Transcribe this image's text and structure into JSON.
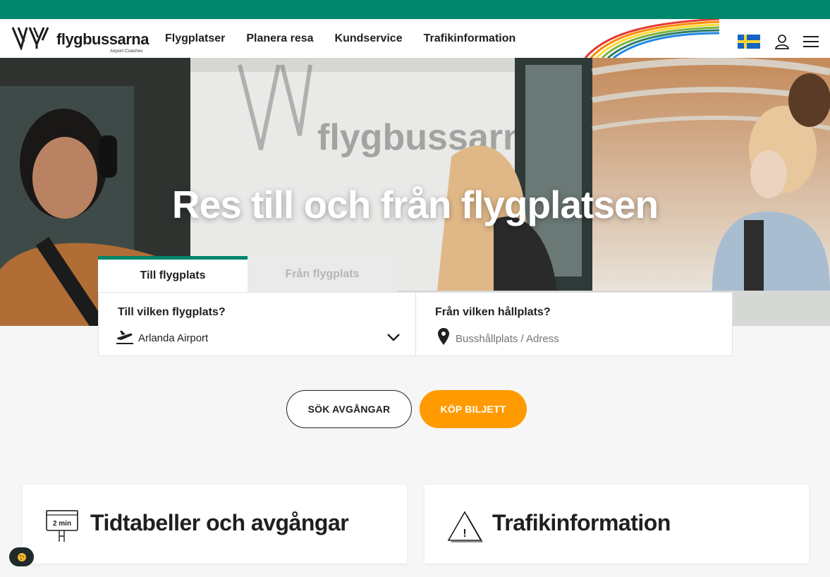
{
  "header": {
    "logo_text": "flygbussarna",
    "logo_sub": "Airport Coaches",
    "nav": [
      {
        "label": "Flygplatser"
      },
      {
        "label": "Planera resa"
      },
      {
        "label": "Kundservice"
      },
      {
        "label": "Trafikinformation"
      }
    ],
    "language_icon": "swedish-flag-icon",
    "account_icon": "user-icon",
    "menu_icon": "hamburger-menu-icon"
  },
  "hero": {
    "title": "Res till och från flygplatsen"
  },
  "search": {
    "tabs": [
      {
        "label": "Till flygplats",
        "active": true
      },
      {
        "label": "Från flygplats",
        "active": false
      }
    ],
    "airport_label": "Till vilken flygplats?",
    "airport_value": "Arlanda Airport",
    "stop_label": "Från vilken hållplats?",
    "stop_placeholder": "Busshållplats / Adress"
  },
  "actions": {
    "search_label": "SÖK AVGÅNGAR",
    "buy_label": "KÖP BILJETT"
  },
  "cards": [
    {
      "title": "Tidtabeller och avgångar",
      "icon": "timetable-sign-icon",
      "icon_text": "2 min"
    },
    {
      "title": "Trafikinformation",
      "icon": "warning-triangle-icon",
      "icon_text": "!"
    }
  ],
  "colors": {
    "brand_green": "#00866a",
    "cta_orange": "#ff9b00"
  }
}
